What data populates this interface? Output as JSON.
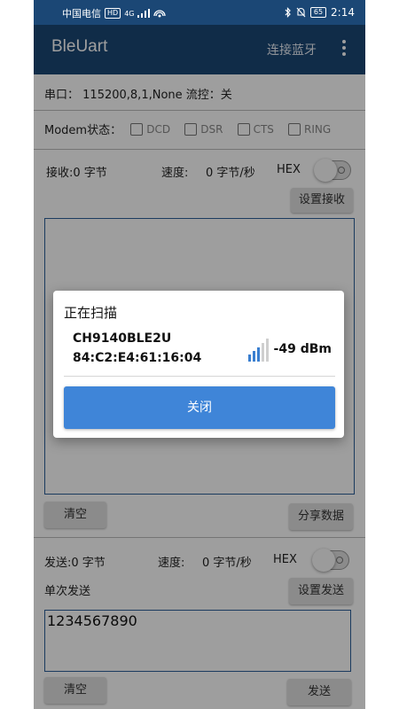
{
  "status_bar": {
    "carrier": "中国电信",
    "hd_badge": "HD",
    "network": "4G",
    "battery": "65",
    "time": "2:14"
  },
  "app_bar": {
    "title": "BleUart",
    "connect_label": "连接蓝牙"
  },
  "serial": {
    "label": "串口：",
    "value": "115200,8,1,None 流控：关"
  },
  "modem": {
    "label": "Modem状态：",
    "items": [
      "DCD",
      "DSR",
      "CTS",
      "RING"
    ]
  },
  "receive": {
    "count_label": "接收:0 字节",
    "speed_label": "速度:",
    "speed_value": "0 字节/秒",
    "hex_label": "HEX",
    "settings_label": "设置接收",
    "clear_label": "清空",
    "share_label": "分享数据"
  },
  "send": {
    "count_label": "发送:0 字节",
    "speed_label": "速度:",
    "speed_value": "0 字节/秒",
    "hex_label": "HEX",
    "mode_label": "单次发送",
    "settings_label": "设置发送",
    "input_value": "1234567890",
    "clear_label": "清空",
    "send_label": "发送"
  },
  "dialog": {
    "title": "正在扫描",
    "device_name": "CH9140BLE2U",
    "device_mac": "84:C2:E4:61:16:04",
    "rssi": "-49 dBm",
    "close_label": "关闭"
  },
  "colors": {
    "app_bar": "#1b4775",
    "accent": "#3f85d8",
    "border": "#2d5f9a"
  }
}
